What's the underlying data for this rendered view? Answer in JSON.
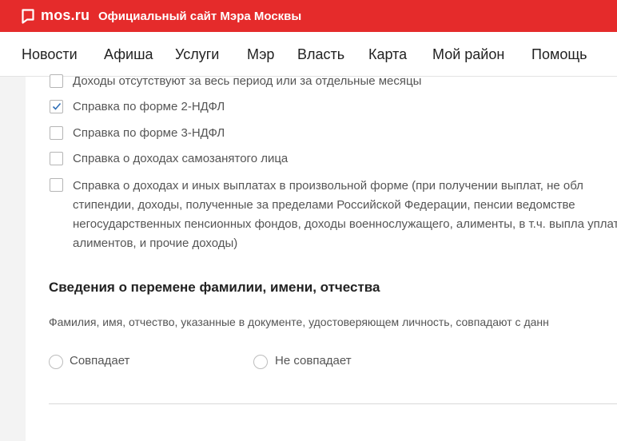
{
  "header": {
    "logo": "mos.ru",
    "tagline": "Официальный сайт Мэра Москвы",
    "brand_color": "#e52b2b"
  },
  "nav": {
    "items": [
      {
        "label": "Новости"
      },
      {
        "label": "Афиша"
      },
      {
        "label": "Услуги"
      },
      {
        "label": "Мэр"
      },
      {
        "label": "Власть"
      },
      {
        "label": "Карта"
      },
      {
        "label": "Мой район"
      },
      {
        "label": "Помощь"
      }
    ]
  },
  "income_docs": [
    {
      "label": "Доходы отсутствуют за весь период или за отдельные месяцы",
      "checked": false
    },
    {
      "label": "Справка по форме 2-НДФЛ",
      "checked": true
    },
    {
      "label": "Справка по форме 3-НДФЛ",
      "checked": false
    },
    {
      "label": "Справка о доходах самозанятого лица",
      "checked": false
    },
    {
      "label": "Справка о доходах и иных выплатах в произвольной форме (при получении выплат, не обл стипендии, доходы, полученные за пределами Российской Федерации, пенсии ведомстве негосударственных пенсионных фондов, доходы военнослужащего, алименты, в т.ч. выпла уплате алиментов, и прочие доходы)",
      "checked": false
    }
  ],
  "name_change": {
    "title": "Сведения о перемене фамилии, имени, отчества",
    "description": "Фамилия, имя, отчество, указанные в документе, удостоверяющем личность, совпадают с данн",
    "options": [
      {
        "label": "Совпадает",
        "selected": false
      },
      {
        "label": "Не совпадает",
        "selected": false
      }
    ]
  }
}
